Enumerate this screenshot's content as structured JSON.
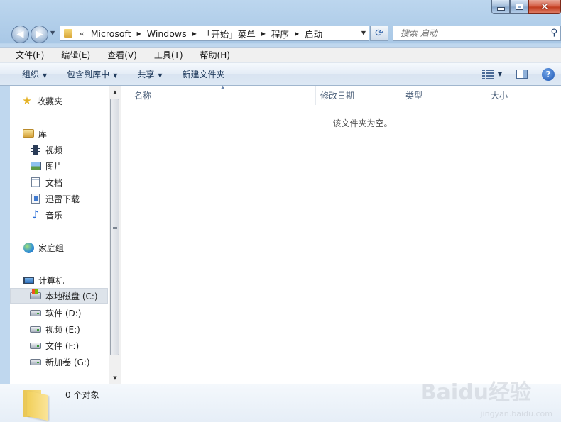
{
  "window": {
    "caption": {
      "minimize_icon": "minimize-icon",
      "maximize_icon": "maximize-icon",
      "close_icon": "close-icon"
    }
  },
  "navbar": {
    "back_icon": "back-arrow-icon",
    "forward_icon": "forward-arrow-icon",
    "overflow_chevron": "«",
    "breadcrumbs": [
      "Microsoft",
      "Windows",
      "「开始」菜单",
      "程序",
      "启动"
    ],
    "search_placeholder": "搜索 启动"
  },
  "menubar": {
    "items": [
      "文件(F)",
      "编辑(E)",
      "查看(V)",
      "工具(T)",
      "帮助(H)"
    ]
  },
  "toolbar": {
    "organize": "组织",
    "include_in_library": "包含到库中",
    "share": "共享",
    "new_folder": "新建文件夹"
  },
  "sidebar": {
    "favorites": "收藏夹",
    "libraries": "库",
    "library_items": [
      "视频",
      "图片",
      "文档",
      "迅雷下载",
      "音乐"
    ],
    "homegroup": "家庭组",
    "computer": "计算机",
    "drives": [
      "本地磁盘 (C:)",
      "软件 (D:)",
      "视频 (E:)",
      "文件 (F:)",
      "新加卷 (G:)"
    ],
    "selected_drive_index": 0
  },
  "columns": [
    "名称",
    "修改日期",
    "类型",
    "大小"
  ],
  "content": {
    "empty_message": "该文件夹为空。"
  },
  "details": {
    "item_count": "0 个对象"
  },
  "watermark": {
    "brand": "Baidu经验",
    "url": "jingyan.baidu.com"
  }
}
